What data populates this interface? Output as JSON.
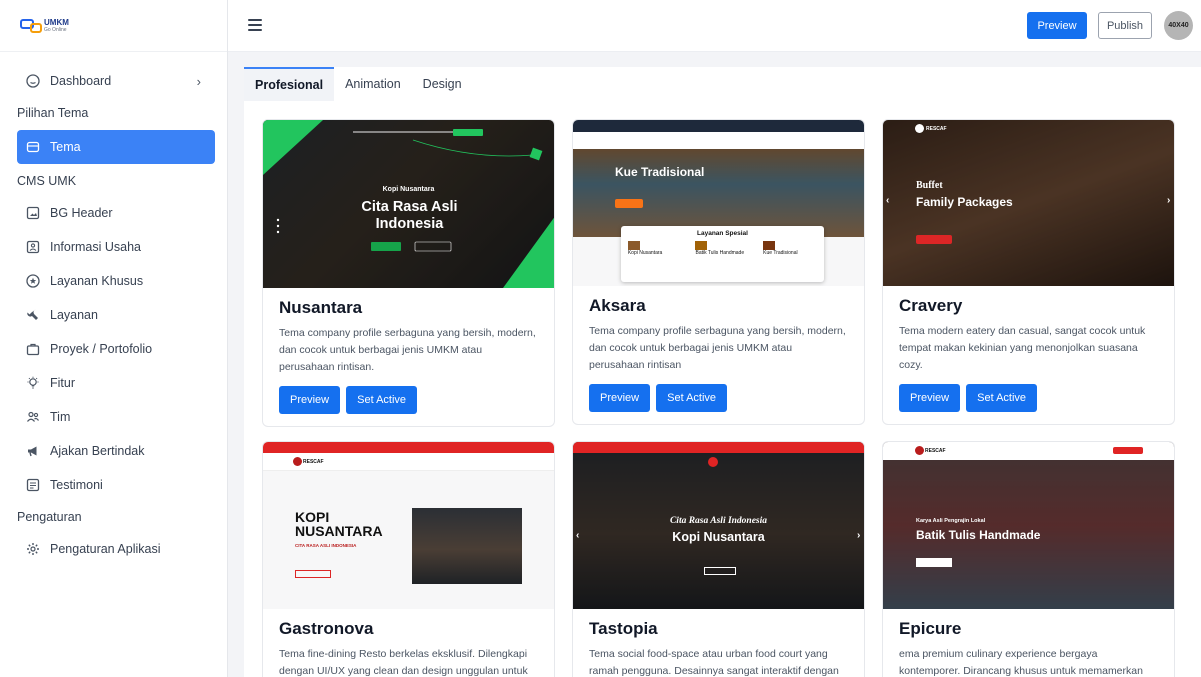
{
  "brand": {
    "name": "UMKM",
    "sub": "Go Online"
  },
  "sidebar": {
    "dashboard": "Dashboard",
    "section_theme": "Pilihan Tema",
    "tema": "Tema",
    "section_cms": "CMS UMK",
    "items": [
      "BG Header",
      "Informasi Usaha",
      "Layanan Khusus",
      "Layanan",
      "Proyek / Portofolio",
      "Fitur",
      "Tim",
      "Ajakan Bertindak",
      "Testimoni"
    ],
    "section_settings": "Pengaturan",
    "settings_item": "Pengaturan Aplikasi"
  },
  "topbar": {
    "preview": "Preview",
    "publish": "Publish",
    "avatar": "40X40"
  },
  "tabs": [
    "Profesional",
    "Animation",
    "Design"
  ],
  "cards": [
    {
      "title": "Nusantara",
      "desc": "Tema company profile serbaguna yang bersih, modern, dan cocok untuk berbagai jenis UMKM atau perusahaan rintisan.",
      "thumb_kicker": "Kopi Nusantara",
      "thumb_title": "Cita Rasa Asli Indonesia"
    },
    {
      "title": "Aksara",
      "desc": "Tema company profile serbaguna yang bersih, modern, dan cocok untuk berbagai jenis UMKM atau perusahaan rintisan",
      "thumb_title": "Kue Tradisional",
      "thumb_sub": "Layanan Spesial",
      "thumb_items": [
        "Kopi Nusantara",
        "Batik Tulis Handmade",
        "Kue Tradisional"
      ]
    },
    {
      "title": "Cravery",
      "desc": "Tema modern eatery dan casual, sangat cocok untuk tempat makan kekinian yang menonjolkan suasana cozy.",
      "thumb_brand": "RESCAF",
      "thumb_kicker": "Buffet",
      "thumb_title": "Family Packages"
    },
    {
      "title": "Gastronova",
      "desc": "Tema fine-dining Resto berkelas eksklusif. Dilengkapi dengan UI/UX yang clean dan design unggulan untuk",
      "thumb_brand": "RESCAF",
      "thumb_title": "KOPI NUSANTARA",
      "thumb_sub": "CITA RASA ASLI INDONESIA"
    },
    {
      "title": "Tastopia",
      "desc": "Tema social food-space atau urban food court yang ramah pengguna. Desainnya sangat interaktif dengan",
      "thumb_brand": "RESCAF",
      "thumb_kicker": "Cita Rasa Asli Indonesia",
      "thumb_title": "Kopi Nusantara"
    },
    {
      "title": "Epicure",
      "desc": "ema premium culinary experience bergaya kontemporer. Dirancang khusus untuk memamerkan",
      "thumb_brand": "RESCAF",
      "thumb_kicker": "Karya Asli Pengrajin Lokal",
      "thumb_title": "Batik Tulis Handmade"
    }
  ],
  "card_actions": {
    "preview": "Preview",
    "set_active": "Set Active"
  },
  "colors": {
    "primary": "#1570ef",
    "active_nav": "#3b82f6",
    "accent_green": "#22c55e",
    "accent_red": "#e02424"
  }
}
